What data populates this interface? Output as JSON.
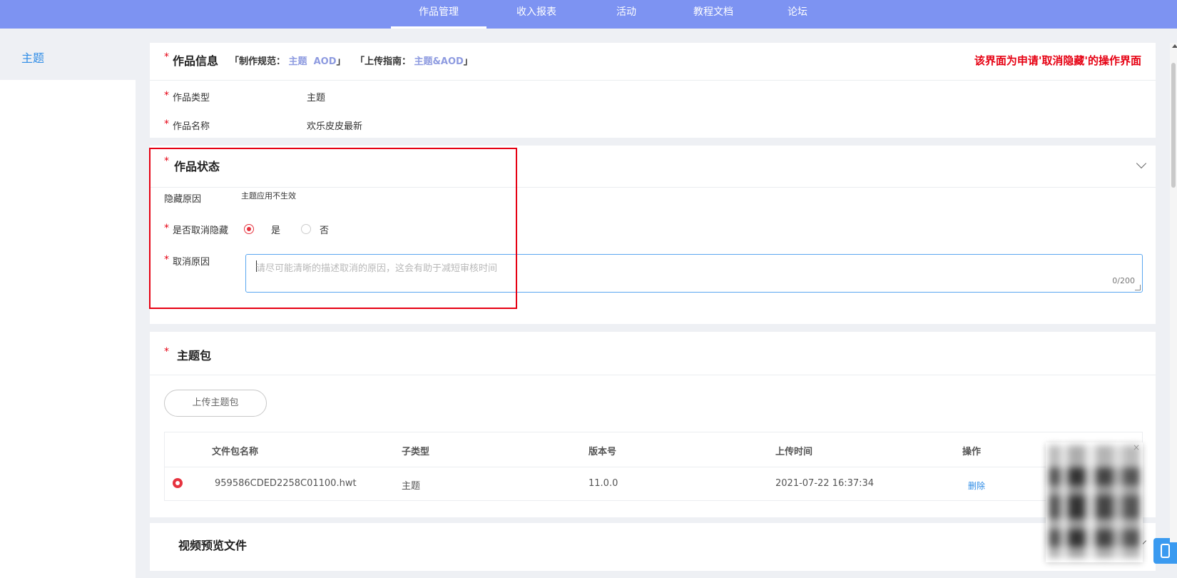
{
  "nav": {
    "items": [
      "作品管理",
      "收入报表",
      "活动",
      "教程文档",
      "论坛"
    ],
    "active_index": 0
  },
  "sidebar": {
    "items": [
      "主题"
    ]
  },
  "work_info": {
    "title": "作品信息",
    "guide_prefix": "「制作规范：",
    "guide_links": [
      "主题",
      "AOD"
    ],
    "guide_close": "」",
    "upload_prefix": "「上传指南：",
    "upload_link": "主题&AOD",
    "upload_close": "」",
    "note": "该界面为申请'取消隐藏'的操作界面",
    "fields": [
      {
        "label": "作品类型",
        "value": "主题"
      },
      {
        "label": "作品名称",
        "value": "欢乐皮皮最新"
      }
    ]
  },
  "work_status": {
    "title": "作品状态",
    "hide_reason_label": "隐藏原因",
    "hide_reason_value": "主题应用不生效",
    "unhide_label": "是否取消隐藏",
    "options": [
      "是",
      "否"
    ],
    "selected": "是",
    "cancel_reason_label": "取消原因",
    "cancel_reason_placeholder": "请尽可能清晰的描述取消的原因，这会有助于减短审核时间",
    "cancel_reason_value": "",
    "counter": "0/200"
  },
  "theme_package": {
    "title": "主题包",
    "upload_button": "上传主题包",
    "columns": [
      "文件包名称",
      "子类型",
      "版本号",
      "上传时间",
      "操作"
    ],
    "rows": [
      {
        "name": "959586CDED2258C01100.hwt",
        "subtype": "主题",
        "version": "11.0.0",
        "time": "2021-07-22 16:37:34",
        "action": "删除"
      }
    ]
  },
  "video_preview": {
    "title": "视频预览文件"
  },
  "qr_popup": {
    "close": "×"
  },
  "colors": {
    "topbar": "#7d93f2",
    "accent": "#2e8ce6",
    "required": "#e60012",
    "radio": "#e6333f"
  }
}
